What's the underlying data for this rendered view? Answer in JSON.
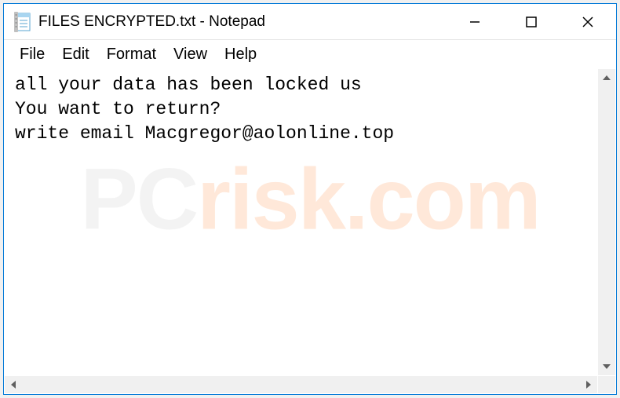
{
  "titlebar": {
    "filename": "FILES ENCRYPTED.txt",
    "appname": "Notepad",
    "full_title": "FILES ENCRYPTED.txt - Notepad"
  },
  "menubar": {
    "file": "File",
    "edit": "Edit",
    "format": "Format",
    "view": "View",
    "help": "Help"
  },
  "content": {
    "line1": "all your data has been locked us",
    "line2": "You want to return?",
    "line3": "write email Macgregor@aolonline.top"
  },
  "watermark": {
    "prefix": "PC",
    "suffix": "risk.com"
  }
}
